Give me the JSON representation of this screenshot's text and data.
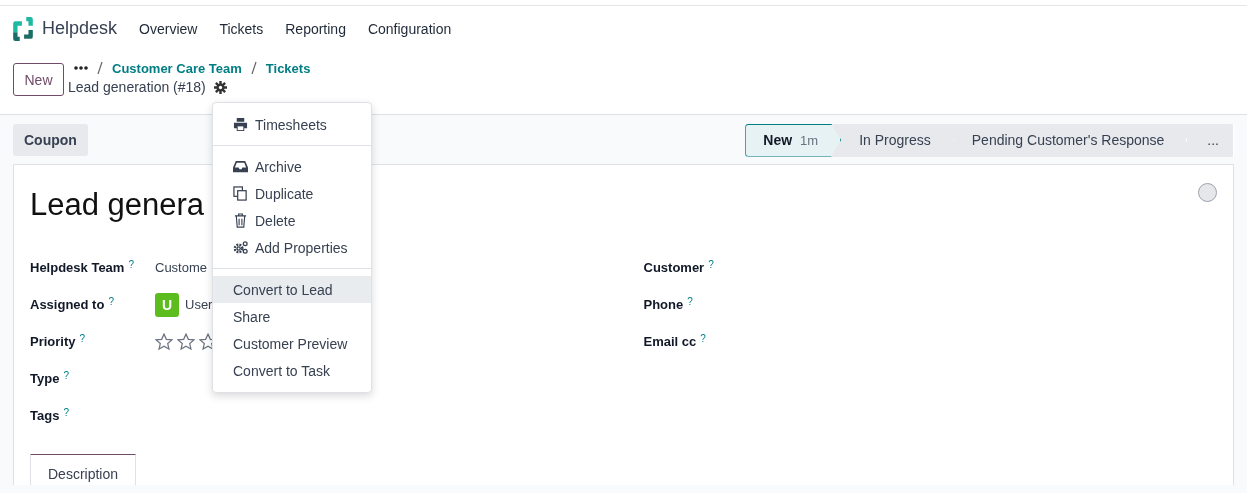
{
  "navbar": {
    "app_name": "Helpdesk",
    "menu": [
      "Overview",
      "Tickets",
      "Reporting",
      "Configuration"
    ]
  },
  "control_panel": {
    "new_button": "New",
    "breadcrumbs": [
      "Customer Care Team",
      "Tickets"
    ],
    "record_title": "Lead generation (#18)"
  },
  "action_menu": {
    "groups": [
      [
        {
          "label": "Timesheets",
          "kind": "printer",
          "selected": false
        }
      ],
      [
        {
          "label": "Archive",
          "kind": "inbox",
          "selected": false
        },
        {
          "label": "Duplicate",
          "kind": "copy",
          "selected": false
        },
        {
          "label": "Delete",
          "kind": "trash",
          "selected": false
        },
        {
          "label": "Add Properties",
          "kind": "gears",
          "selected": false
        }
      ],
      [
        {
          "label": "Convert to Lead",
          "kind": "plain",
          "selected": true
        },
        {
          "label": "Share",
          "kind": "plain",
          "selected": false
        },
        {
          "label": "Customer Preview",
          "kind": "plain",
          "selected": false
        },
        {
          "label": "Convert to Task",
          "kind": "plain",
          "selected": false
        }
      ]
    ]
  },
  "button_box": {
    "buttons": [
      "Coupon"
    ]
  },
  "status_bar": {
    "stages": [
      {
        "label": "New",
        "duration": "1m",
        "selected": true
      },
      {
        "label": "In Progress",
        "selected": false
      },
      {
        "label": "Pending Customer's Response",
        "selected": false
      }
    ],
    "more": "..."
  },
  "form": {
    "title": "Lead genera",
    "left_fields": [
      {
        "label": "Helpdesk Team",
        "help": "?",
        "kind": "text",
        "value": "Custome"
      },
      {
        "label": "Assigned to",
        "help": "?",
        "kind": "user",
        "avatar": "U",
        "value": "User"
      },
      {
        "label": "Priority",
        "help": "?",
        "kind": "stars",
        "stars": 0
      },
      {
        "label": "Type",
        "help": "?",
        "kind": "empty"
      },
      {
        "label": "Tags",
        "help": "?",
        "kind": "empty"
      }
    ],
    "right_fields": [
      {
        "label": "Customer",
        "help": "?"
      },
      {
        "label": "Phone",
        "help": "?"
      },
      {
        "label": "Email cc",
        "help": "?"
      }
    ],
    "tabs": [
      {
        "label": "Description",
        "selected": true
      }
    ]
  }
}
